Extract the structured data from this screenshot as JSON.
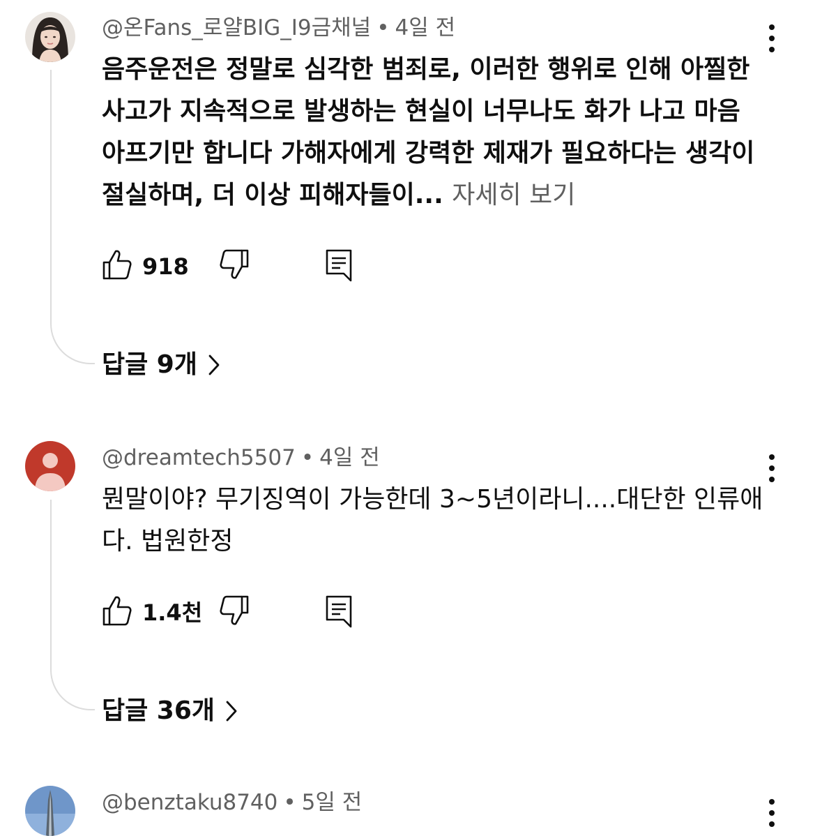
{
  "comments": [
    {
      "handle": "@온Fans_로얄BIG_I9금채널",
      "time": "4일 전",
      "text": "음주운전은 정말로 심각한 범죄로, 이러한 행위로 인해 아찔한 사고가 지속적으로 발생하는 현실이 너무나도 화가 나고 마음 아프기만 합니다 가해자에게 강력한 제재가 필요하다는 생각이 절실하며, 더 이상 피해자들이...",
      "more_label": "자세히 보기",
      "likes": "918",
      "replies_label": "답글 9개"
    },
    {
      "handle": "@dreamtech5507",
      "time": "4일 전",
      "text": "뭔말이야? 무기징역이 가능한데 3~5년이라니....대단한 인류애다. 법원한정",
      "likes": "1.4천",
      "replies_label": "답글 36개"
    },
    {
      "handle": "@benztaku8740",
      "time": "5일 전"
    }
  ],
  "separator": "•",
  "colors": {
    "text_primary": "#0f0f0f",
    "text_secondary": "#606060",
    "thread_line": "#dcdcdc",
    "default_avatar_bg": "#c0392b",
    "default_avatar_fg": "#f4c9c2"
  },
  "icons": {
    "like": "thumbs-up-icon",
    "dislike": "thumbs-down-icon",
    "reply": "comment-icon",
    "menu": "more-vert-icon",
    "replies": "chevron-right-icon"
  }
}
